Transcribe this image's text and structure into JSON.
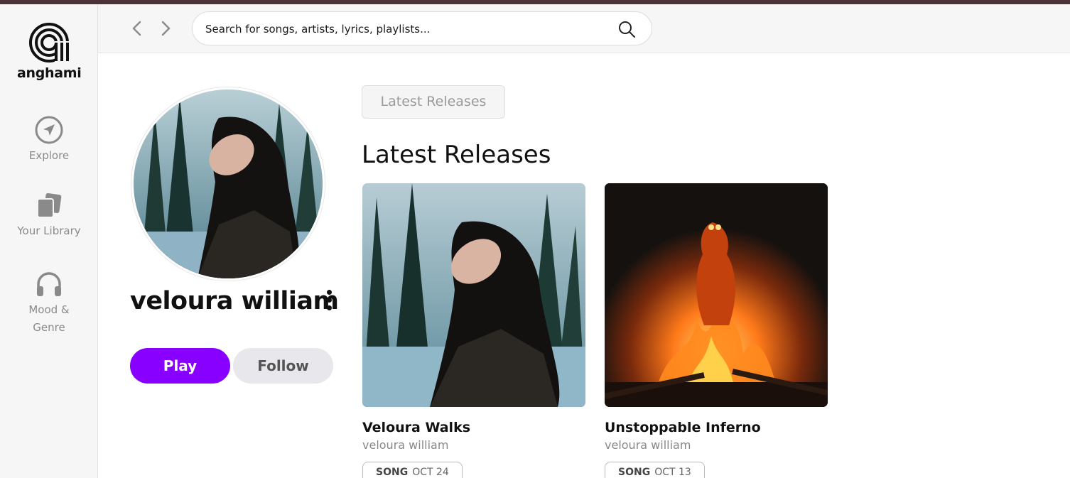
{
  "app": {
    "logo_text": "anghami"
  },
  "sidebar": {
    "items": [
      {
        "label": "Explore",
        "icon": "explore-icon"
      },
      {
        "label": "Your Library",
        "icon": "library-icon"
      },
      {
        "label": "Mood & Genre",
        "icon": "headphones-icon"
      }
    ]
  },
  "header": {
    "search_placeholder": "Search for songs, artists, lyrics, playlists..."
  },
  "artist": {
    "name": "veloura william",
    "play_label": "Play",
    "follow_label": "Follow"
  },
  "content": {
    "filter_chip": "Latest Releases",
    "section_title": "Latest Releases",
    "releases": [
      {
        "title": "Veloura Walks",
        "artist": "veloura william",
        "type": "SONG",
        "date": "OCT 24"
      },
      {
        "title": "Unstoppable Inferno",
        "artist": "veloura william",
        "type": "SONG",
        "date": "OCT 13"
      }
    ]
  },
  "colors": {
    "accent": "#8800ff",
    "top_strip": "#4a3236",
    "sidebar_bg": "#f6f6f6"
  }
}
